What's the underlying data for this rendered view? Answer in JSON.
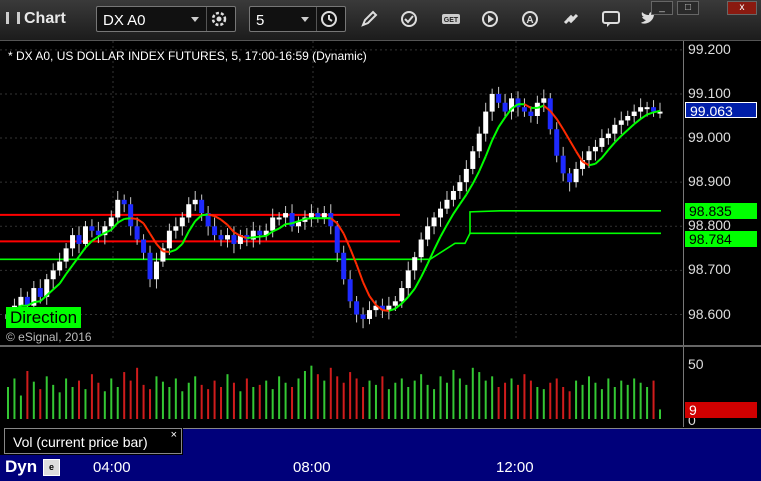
{
  "toolbar": {
    "app_title": "Chart",
    "symbol": "DX A0",
    "interval": "5",
    "icons": [
      "settings-gear-icon",
      "clock-icon",
      "pencil-icon",
      "refresh-icon",
      "get-icon",
      "play-icon",
      "alert-icon",
      "link-icon",
      "chat-icon",
      "twitter-icon"
    ],
    "window_buttons": [
      "_",
      "□",
      "x"
    ]
  },
  "chart": {
    "description": "* DX A0, US DOLLAR INDEX FUTURES, 5, 17:00-16:59 (Dynamic)",
    "indicator_label": "Direction",
    "copyright": "© eSignal, 2016",
    "price_ticks": [
      "99.200",
      "99.100",
      "99.000",
      "98.900",
      "98.800",
      "98.700",
      "98.600"
    ],
    "tags": {
      "last": "99.063",
      "upper": "98.835",
      "lower": "98.784"
    },
    "colors": {
      "up_candle": "#ffffff",
      "down_candle": "#1e2aff",
      "fast_ma_up": "#00ff00",
      "fast_ma_down": "#ff2a00",
      "red_line": "#ff0000",
      "green_line": "#00ff00",
      "last_tag_bg": "#001ea8"
    }
  },
  "volume": {
    "label": "Vol (current price bar)",
    "close_glyph": "×",
    "ticks": [
      "50",
      "0"
    ],
    "value": "9"
  },
  "bottom": {
    "mode": "Dyn",
    "times": [
      "04:00",
      "08:00",
      "12:00"
    ]
  },
  "chart_data": {
    "type": "candlestick",
    "ylim": [
      98.54,
      99.22
    ],
    "closes": [
      98.6,
      98.62,
      98.64,
      98.62,
      98.66,
      98.64,
      98.68,
      98.7,
      98.72,
      98.75,
      98.78,
      98.76,
      98.8,
      98.79,
      98.78,
      98.8,
      98.82,
      98.86,
      98.85,
      98.8,
      98.77,
      98.74,
      98.68,
      98.72,
      98.75,
      98.79,
      98.8,
      98.82,
      98.85,
      98.86,
      98.83,
      98.8,
      98.78,
      98.77,
      98.78,
      98.76,
      98.78,
      98.77,
      98.79,
      98.78,
      98.79,
      98.82,
      98.82,
      98.83,
      98.8,
      98.81,
      98.82,
      98.83,
      98.82,
      98.83,
      98.8,
      98.74,
      98.68,
      98.63,
      98.6,
      98.59,
      98.61,
      98.62,
      98.61,
      98.62,
      98.63,
      98.66,
      98.7,
      98.73,
      98.77,
      98.8,
      98.82,
      98.84,
      98.86,
      98.88,
      98.9,
      98.93,
      98.97,
      99.01,
      99.06,
      99.1,
      99.08,
      99.06,
      99.09,
      99.07,
      99.06,
      99.05,
      99.08,
      99.09,
      99.02,
      98.96,
      98.92,
      98.9,
      98.93,
      98.95,
      98.97,
      98.98,
      99.0,
      99.01,
      99.03,
      99.04,
      99.05,
      99.06,
      99.07,
      99.07,
      99.06,
      99.06
    ],
    "upper_level": 98.835,
    "lower_level": 98.784,
    "last": 99.063,
    "volume": [
      30,
      38,
      22,
      45,
      35,
      28,
      40,
      32,
      25,
      38,
      30,
      36,
      28,
      42,
      34,
      26,
      38,
      30,
      44,
      36,
      48,
      32,
      28,
      40,
      35,
      30,
      38,
      26,
      34,
      40,
      32,
      28,
      36,
      30,
      42,
      34,
      26,
      38,
      30,
      32,
      36,
      28,
      40,
      34,
      30,
      38,
      45,
      50,
      42,
      36,
      48,
      40,
      34,
      44,
      38,
      30,
      36,
      32,
      40,
      28,
      34,
      38,
      30,
      36,
      42,
      32,
      28,
      40,
      34,
      46,
      38,
      32,
      48,
      44,
      36,
      40,
      30,
      34,
      38,
      32,
      42,
      36,
      30,
      28,
      34,
      38,
      30,
      26,
      36,
      32,
      40,
      34,
      28,
      38,
      30,
      36,
      32,
      38,
      34,
      30,
      36,
      9
    ],
    "volume_max": 60,
    "time_labels": [
      "04:00",
      "08:00",
      "12:00"
    ]
  }
}
